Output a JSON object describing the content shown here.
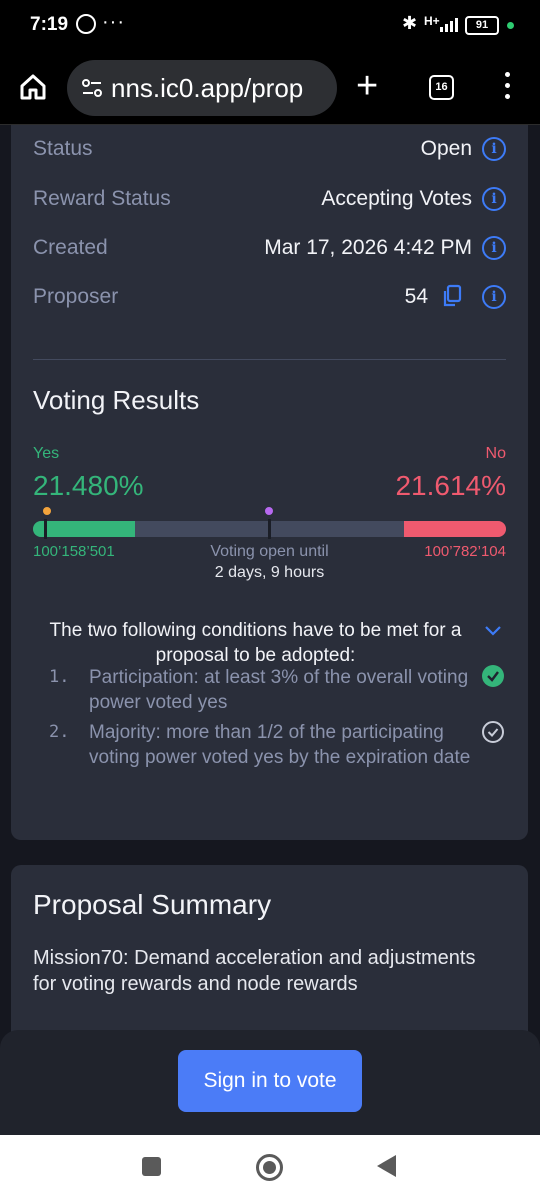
{
  "status_bar": {
    "time": "7:19",
    "battery": "91",
    "signal_label": "H+"
  },
  "browser": {
    "url": "nns.ic0.app/prop",
    "tab_count": "16"
  },
  "details": [
    {
      "label": "Status",
      "value": "Open"
    },
    {
      "label": "Reward Status",
      "value": "Accepting Votes"
    },
    {
      "label": "Created",
      "value": "Mar 17, 2026 4:42 PM"
    },
    {
      "label": "Proposer",
      "value": "54"
    }
  ],
  "voting": {
    "title": "Voting Results",
    "yes_label": "Yes",
    "no_label": "No",
    "yes_percent": "21.480%",
    "no_percent": "21.614%",
    "yes_votes": "100’158’501",
    "no_votes": "100’782’104",
    "voting_open_label": "Voting open until",
    "time_remaining": "2 days, 9 hours",
    "yes_fraction": 0.2148,
    "no_fraction": 0.21614
  },
  "conditions": {
    "title": "The two following conditions have to be met for a proposal to be adopted:",
    "items": [
      {
        "num": "1.",
        "text": "Participation: at least 3% of the overall voting power voted yes",
        "met": true
      },
      {
        "num": "2.",
        "text": "Majority: more than 1/2 of the participating voting power voted yes by the expiration date",
        "met": false
      }
    ]
  },
  "summary": {
    "title": "Proposal Summary",
    "text": "Mission70: Demand acceleration and adjustments for voting rewards and node rewards"
  },
  "sign_in_label": "Sign in to vote",
  "colors": {
    "yes": "#34b57a",
    "no": "#ef5a6f",
    "accent": "#4b7cf7",
    "card": "#2a2e3a"
  }
}
